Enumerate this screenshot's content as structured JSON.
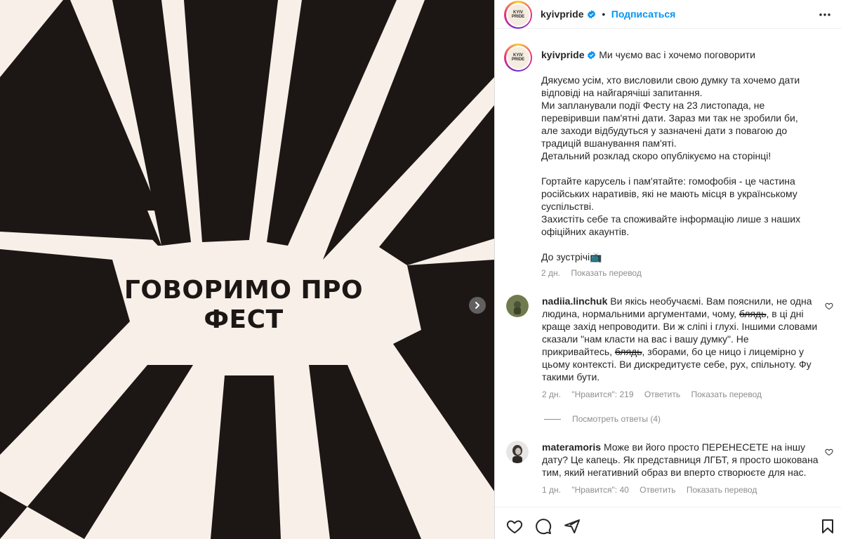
{
  "post": {
    "headline_line1": "ГОВОРИМО ПРО",
    "headline_line2": "ФЕСТ"
  },
  "header": {
    "username": "kyivpride",
    "follow_label": "Подписаться",
    "separator": "•",
    "avatar_text": "KYIV PRIDE"
  },
  "caption": {
    "username": "kyivpride",
    "first_line": "Ми чуємо вас і хочемо поговорити",
    "paragraphs": [
      "Дякуємо усім, хто висловили свою думку та хочемо дати відповіді на найгарячіші запитання.",
      "Ми запланували події Фесту на 23 листопада, не перевіривши пам'ятні дати. Зараз ми так не зробили би, але заходи відбудуться у зазначені дати з повагою до традицій вшанування пам'яті.",
      "Детальний розклад скоро опублікуємо на сторінці!",
      "",
      "Гортайте карусель і пам'ятайте: гомофобія - це частина російських наративів, які не мають місця в українському суспільстві.",
      "Захистіть себе та споживайте інформацію лише з наших офіційних акаунтів.",
      "",
      "До зустрічі📺"
    ],
    "time": "2 дн.",
    "translate_label": "Показать перевод"
  },
  "comments": [
    {
      "username": "nadiia.linchuk",
      "text_parts": [
        "Ви якісь необучаємі. Вам пояснили, не одна людина, нормальними аргументами, чому, ",
        "блядь",
        ", в ці дні краще захід непроводити. Ви ж сліпі і глухі. Іншими словами сказали \"нам класти на вас і вашу думку\". Не прикривайтесь, ",
        "блядь",
        ", зборами, бо це ницо і лицемірно у цьому контексті. Ви дискредитуєте себе, рух, спільноту. Фу такими бути."
      ],
      "time": "2 дн.",
      "likes": "\"Нравится\": 219",
      "reply_label": "Ответить",
      "translate_label": "Показать перевод",
      "view_replies": "Посмотреть ответы (4)"
    },
    {
      "username": "materamoris",
      "text": "Може ви його просто ПЕРЕНЕСЕТЕ на іншу дату? Це капець. Як представниця ЛГБТ, я просто шокована тим, який негативний образ ви вперто створюєте для нас.",
      "time": "1 дн.",
      "likes": "\"Нравится\": 40",
      "reply_label": "Ответить",
      "translate_label": "Показать перевод"
    }
  ],
  "colors": {
    "accent": "#0095f6",
    "muted": "#8e8e8e",
    "post_background": "#f7efe8",
    "post_rays": "#1c1714"
  },
  "icons": [
    "more-options-icon",
    "verified-badge-icon",
    "heart-icon",
    "comment-icon",
    "share-icon",
    "bookmark-icon",
    "carousel-next-icon"
  ]
}
